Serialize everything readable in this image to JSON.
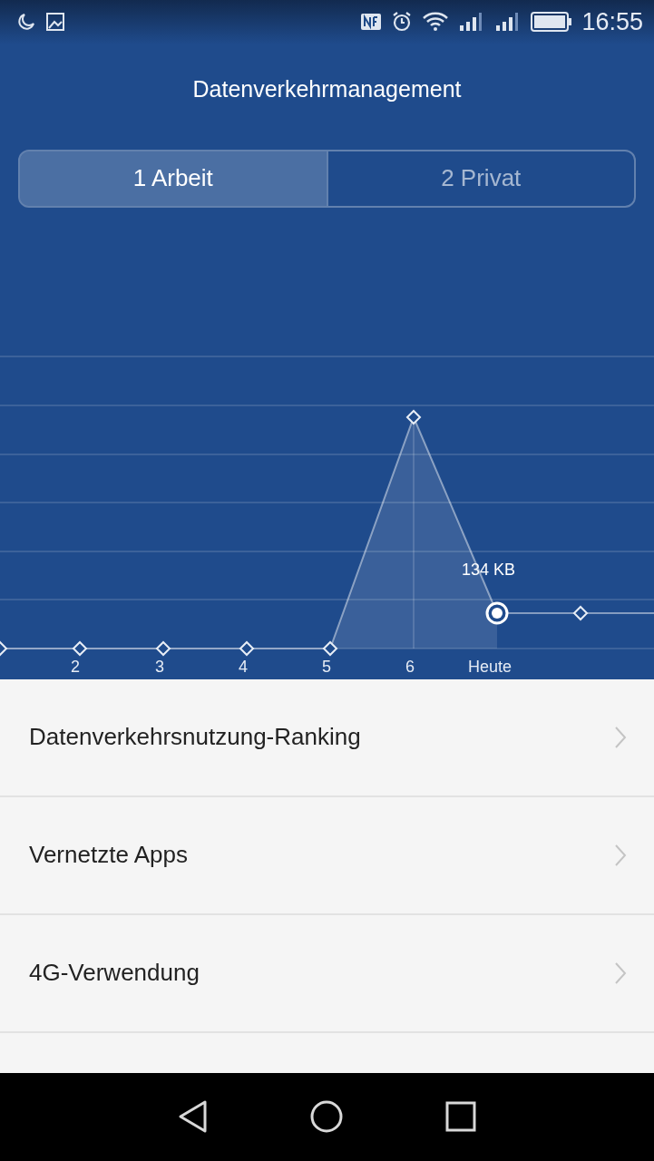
{
  "status_bar": {
    "time": "16:55"
  },
  "title": "Datenverkehrmanagement",
  "tabs": [
    {
      "label": "1 Arbeit",
      "selected": true
    },
    {
      "label": "2 Privat",
      "selected": false
    }
  ],
  "chart": {
    "day_labels": [
      "2",
      "3",
      "4",
      "5",
      "6",
      "Heute"
    ],
    "callout": "134 KB"
  },
  "menu": [
    {
      "label": "Datenverkehrsnutzung-Ranking"
    },
    {
      "label": "Vernetzte Apps"
    },
    {
      "label": "4G-Verwendung"
    }
  ]
}
